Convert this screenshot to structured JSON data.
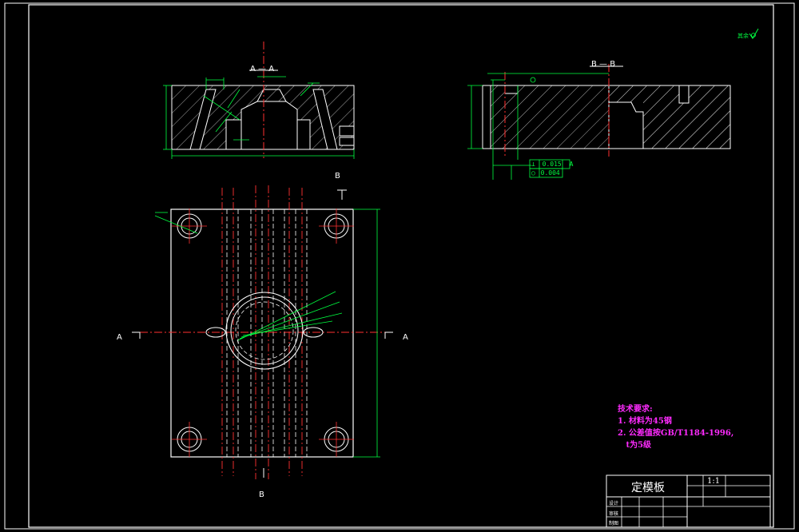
{
  "colors": {
    "background": "#000000",
    "outline": "#ffffff",
    "center_line": "#ff3030",
    "dimension": "#00ff40",
    "hatch": "#d8d8d8",
    "note": "#ff2bff",
    "leader_gray": "#b0b0b0"
  },
  "section_labels": {
    "aa_top": "A — A",
    "bb_top": "B — B",
    "b_top": "B",
    "b_bottom": "B",
    "a_left": "A",
    "a_right": "A"
  },
  "tolerance_frames": [
    {
      "symbol": "⊥",
      "value": "0.015",
      "datum": "A"
    },
    {
      "symbol": "◯",
      "value": "0.004",
      "datum": ""
    }
  ],
  "technical_requirements": {
    "heading": "技术要求:",
    "items": [
      "1. 材料为45钢",
      "2. 公差值按GB/T1184-1996,",
      "   t为5级"
    ]
  },
  "title_block": {
    "part_name": "定模板",
    "scale": "1:1",
    "labels_small": [
      "设计",
      "审核",
      "制图"
    ]
  },
  "roughness_mark": "其余"
}
